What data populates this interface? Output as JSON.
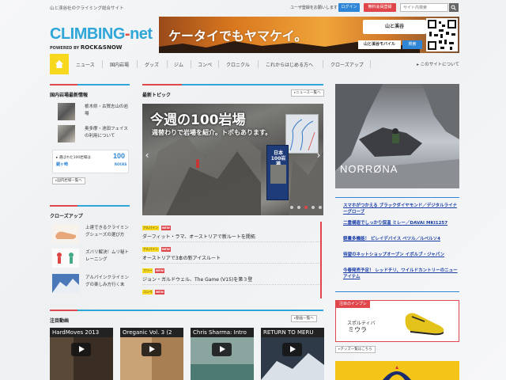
{
  "header": {
    "tagline": "山と渓谷社のクライミング総合サイト",
    "user_register": "ユーザ登録をお願いします",
    "login_label": "ログイン",
    "register_label": "無料会員登録",
    "search_placeholder": "サイト内検索"
  },
  "logo": {
    "main_part1": "CLIMBING",
    "main_dash": "-",
    "main_part2": "net",
    "powered_by": "POWERED BY",
    "brand": "ROCK&SNOW"
  },
  "banner": {
    "text": "ケータイでもヤマケイ。",
    "brand": "山と溪谷",
    "mobile": "山と溪谷モバイル",
    "search": "検索"
  },
  "nav": {
    "items": [
      "ニュース",
      "国内岩場",
      "グッズ",
      "ジム",
      "コンペ",
      "クロニクル",
      "これからはじめる方へ",
      "クローズアップ"
    ],
    "about": "▸ このサイトについて"
  },
  "domestic_spots": {
    "title": "国内岩場最新情報",
    "items": [
      "栃木県・古賀志山の岩場",
      "奥多摩・池田フェイスの利用について"
    ],
    "rock100_label": "▸ 選ばれた100岩場は",
    "rock100_name": "鋸ヶ崎",
    "rock100_logo": "100",
    "rock100_logo_sub": "ROCKS",
    "more": "国内岩場一覧へ"
  },
  "closeup": {
    "title": "クローズアップ",
    "items": [
      "上達できるクライミングシューズの選び方",
      "ズバリ解決！ムリ秘トレーニング",
      "アルパインクライミングの楽しみ方行く末"
    ]
  },
  "topics": {
    "title": "最新トピック",
    "more": "ニュース一覧へ",
    "slide_title": "今週の100岩場",
    "slide_sub": "週替わりで岩場を紹介。トポもあります。",
    "slide_book": "日本100岩場",
    "items": [
      {
        "tag": "アルパイン",
        "new": "NEW",
        "text": "ダーフィット・ラマ、オーストリアで新ルートを開拓"
      },
      {
        "tag": "アルパイン",
        "new": "NEW",
        "text": "オーストリアで3本の新アイスルート"
      },
      {
        "tag": "フリー",
        "new": "NEW",
        "text": "ジョン・ガルドウェル、The Game (V15)を第３登"
      },
      {
        "tag": "コンペ",
        "new": "NEW",
        "text": ""
      }
    ]
  },
  "videos": {
    "title": "注目動画",
    "more": "動画一覧へ",
    "items": [
      "HardMoves 2013",
      "Oreganic Vol. 3 (2",
      "Chris Sharma: Intro",
      "RETURN TO MERU"
    ]
  },
  "right_ad": {
    "brand": "NORRØNA",
    "links": [
      "スマホがつかえる ブラックダイヤモンド／デジタルライナーグローブ",
      "二重構造でしっかり保温 ミレー／DAVAI MKI1257",
      "軽量多機能！ ピレイデバイス ペツル／ルベルソ4",
      "待望のネットショップオープン イボルブ・ジャパン",
      "今春発売予定！ レッドチリ、ワイルドカントリーのニューアイテム"
    ]
  },
  "impression": {
    "title": "注目のインプレ",
    "brand": "スポルティバ",
    "name": "ミウラ",
    "more": "グッズ一覧はこちら"
  },
  "colors": {
    "accent_blue": "#2fa6d8",
    "accent_red": "#e0474c",
    "nav_home": "#f7d81e",
    "link_blue": "#1a3ea8"
  }
}
